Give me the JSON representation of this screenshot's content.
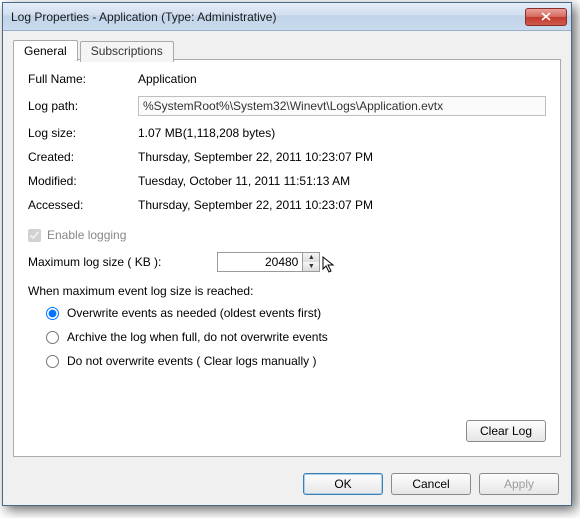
{
  "window": {
    "title": "Log Properties - Application (Type: Administrative)"
  },
  "tabs": {
    "general": "General",
    "subscriptions": "Subscriptions"
  },
  "fields": {
    "fullname_label": "Full Name:",
    "fullname_value": "Application",
    "logpath_label": "Log path:",
    "logpath_value": "%SystemRoot%\\System32\\Winevt\\Logs\\Application.evtx",
    "logsize_label": "Log size:",
    "logsize_value": "1.07 MB(1,118,208 bytes)",
    "created_label": "Created:",
    "created_value": "Thursday, September 22, 2011 10:23:07 PM",
    "modified_label": "Modified:",
    "modified_value": "Tuesday, October 11, 2011 11:51:13 AM",
    "accessed_label": "Accessed:",
    "accessed_value": "Thursday, September 22, 2011 10:23:07 PM"
  },
  "enable_logging_label": "Enable logging",
  "enable_logging_checked": true,
  "maxsize": {
    "label": "Maximum log size ( KB ):",
    "value": "20480"
  },
  "when_label": "When maximum event log size is reached:",
  "radios": {
    "overwrite": "Overwrite events as needed (oldest events first)",
    "archive": "Archive the log when full, do not overwrite events",
    "donot": "Do not overwrite events ( Clear logs manually )"
  },
  "buttons": {
    "clearlog": "Clear Log",
    "ok": "OK",
    "cancel": "Cancel",
    "apply": "Apply"
  }
}
